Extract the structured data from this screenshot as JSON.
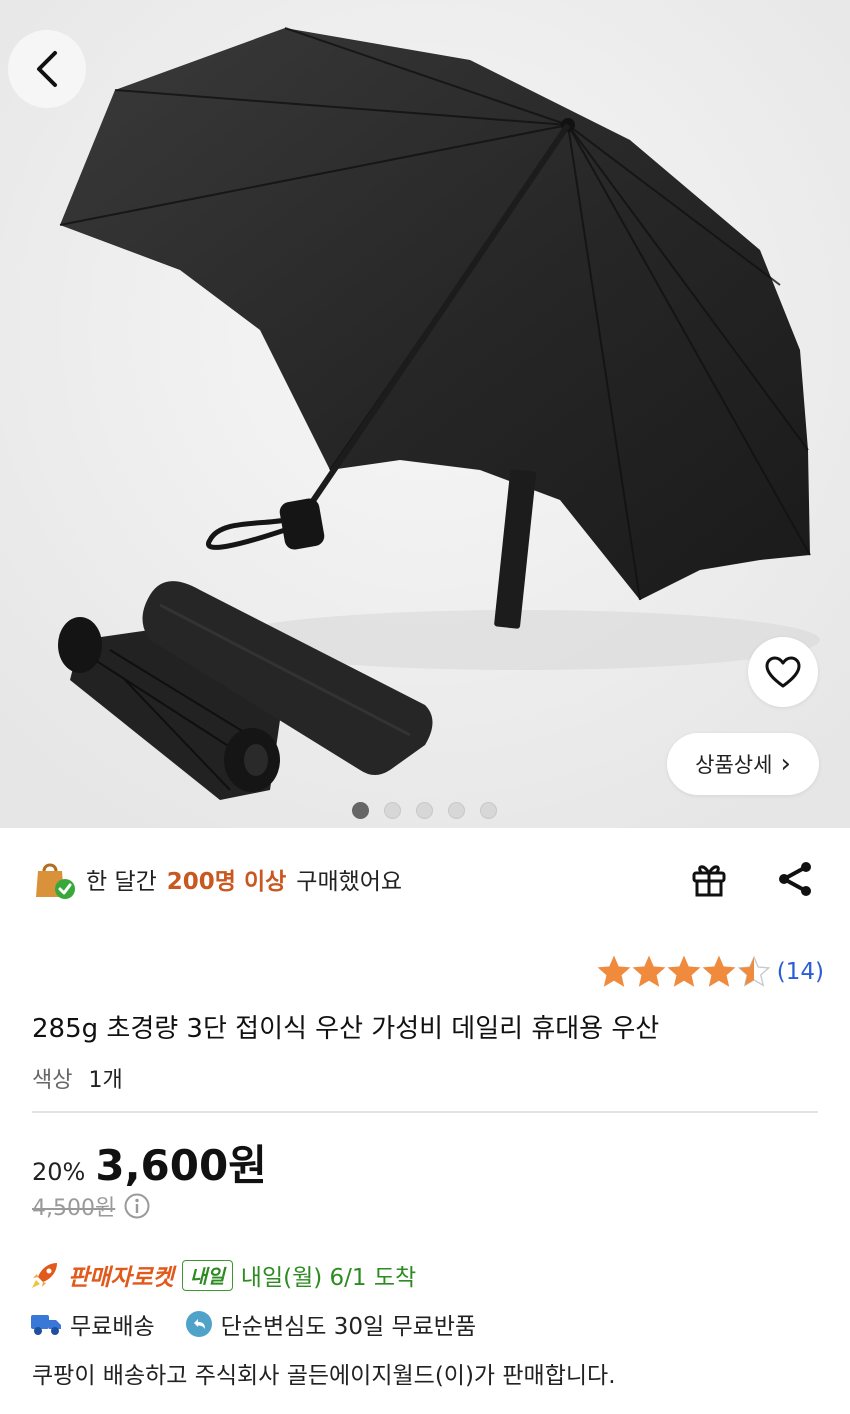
{
  "gallery": {
    "detail_label": "상품상세",
    "detail_chevron": "›",
    "image_count": 5,
    "active_index": 0,
    "icons": {
      "back": "chevron-left-icon",
      "wishlist": "heart-icon"
    }
  },
  "banner": {
    "prefix": "한 달간",
    "highlight": "200명 이상",
    "suffix": "구매했어요",
    "icons": {
      "bag": "shopping-bag-check-icon",
      "gift": "gift-icon",
      "share": "share-icon"
    }
  },
  "rating": {
    "stars": 4.5,
    "max_stars": 5,
    "count_text": "(14)"
  },
  "product": {
    "title": "285g 초경량 3단 접이식 우산 가성비 데일리 휴대용 우산",
    "option_label": "색상",
    "option_value": "1개"
  },
  "price": {
    "discount": "20%",
    "sale_price": "3,600원",
    "original_price": "4,500원"
  },
  "delivery": {
    "seller_rocket": "판매자로켓",
    "tomorrow_badge": "내일",
    "arrival": "내일(월) 6/1 도착",
    "free_shipping": "무료배송",
    "free_return": "단순변심도 30일 무료반품",
    "seller_note": "쿠팡이 배송하고 주식회사 골든에이지월드(이)가 판매합니다."
  },
  "colors": {
    "highlight_orange": "#c8581f",
    "star": "#f08a3c",
    "review_blue": "#2a5dd6",
    "delivery_green": "#2e8b22",
    "rocket_orange": "#e2591c"
  }
}
